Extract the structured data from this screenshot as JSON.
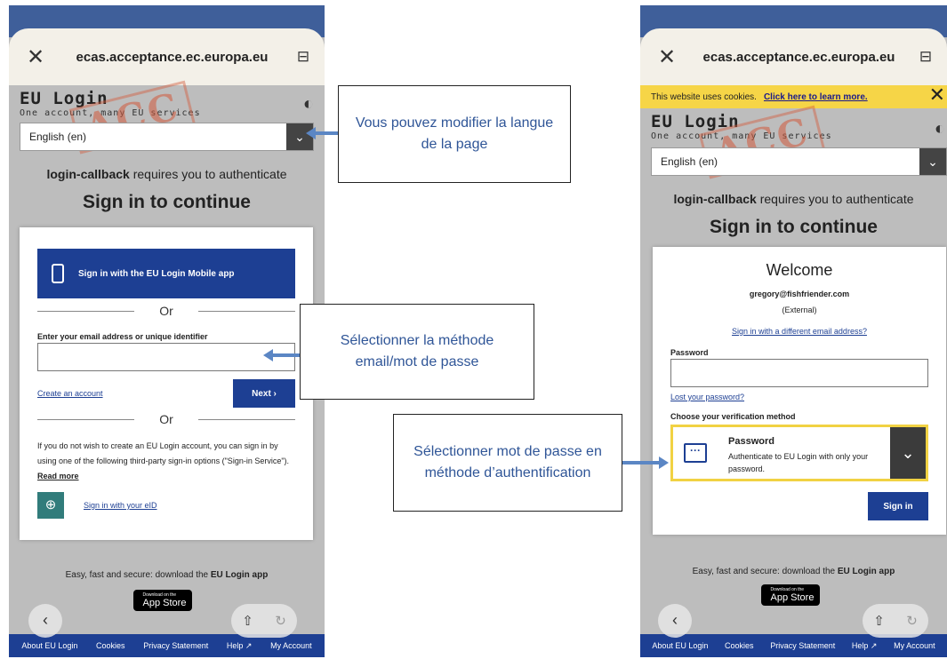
{
  "left": {
    "url": "ecas.acceptance.ec.europa.eu",
    "brand_title": "EU Login",
    "brand_sub": "One account, many EU services",
    "stamp": "ACC",
    "language": "English (en)",
    "auth_app": "login-callback",
    "auth_rest": " requires you to authenticate",
    "heading": "Sign in to continue",
    "mobile_button": "Sign in with the EU Login Mobile app",
    "or": "Or",
    "email_label": "Enter your email address or unique identifier",
    "create_account": "Create an account",
    "next": "Next ›",
    "third_party_text": "If you do not wish to create an EU Login account, you can sign in by using one of the following third-party sign-in options (\"Sign-in Service\").",
    "read_more": "Read more",
    "eid": "Sign in with your eID",
    "download_text": "Easy, fast and secure: download the ",
    "download_app": "EU Login app",
    "appstore_small": "Download on the",
    "appstore": "App Store",
    "footer": [
      "About EU Login",
      "Cookies",
      "Privacy Statement",
      "Help ↗",
      "My Account"
    ]
  },
  "right": {
    "url": "ecas.acceptance.ec.europa.eu",
    "cookie_text": "This website uses cookies.",
    "cookie_link": "Click here to learn more.",
    "brand_title": "EU Login",
    "brand_sub": "One account, many EU services",
    "stamp": "ACC",
    "language": "English (en)",
    "auth_app": "login-callback",
    "auth_rest": " requires you to authenticate",
    "heading": "Sign in to continue",
    "welcome": "Welcome",
    "email": "gregory@fishfriender.com",
    "external": "(External)",
    "different_email": "Sign in with a different email address?",
    "password_label": "Password",
    "lost_password": "Lost your password?",
    "choose_method": "Choose your verification method",
    "method_title": "Password",
    "method_desc": "Authenticate to EU Login with only your password.",
    "sign_in": "Sign in",
    "download_text": "Easy, fast and secure: download the ",
    "download_app": "EU Login app",
    "appstore_small": "Download on the",
    "appstore": "App Store",
    "footer": [
      "About EU Login",
      "Cookies",
      "Privacy Statement",
      "Help ↗",
      "My Account"
    ]
  },
  "notes": {
    "language": "Vous pouvez modifier la langue de la page",
    "email_method": "Sélectionner la méthode email/mot de passe",
    "password_method": "Sélectionner mot de passe en méthode d’authentification"
  },
  "colors": {
    "eu_blue": "#1d3f93",
    "cookie_yellow": "#f6d547",
    "annotation_blue": "#2f5597",
    "arrow": "#5b86c4"
  }
}
